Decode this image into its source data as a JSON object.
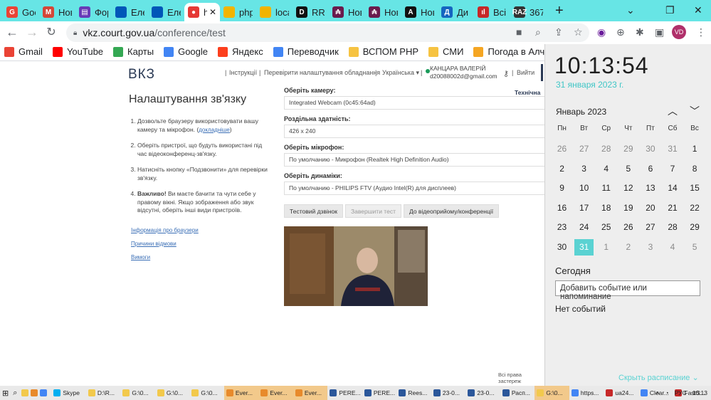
{
  "tabs": [
    {
      "label": "Goo",
      "color": "#ea4335",
      "glyph": "G"
    },
    {
      "label": "Нов",
      "color": "#d44638",
      "glyph": "M"
    },
    {
      "label": "Фор",
      "color": "#673ab7",
      "glyph": "▤"
    },
    {
      "label": "Еле",
      "color": "#0057b8",
      "glyph": ""
    },
    {
      "label": "Еле",
      "color": "#0057b8",
      "glyph": ""
    },
    {
      "label": "ht",
      "color": "#e53935",
      "glyph": "●",
      "active": true
    },
    {
      "label": "php",
      "color": "#f2b400",
      "glyph": ""
    },
    {
      "label": "loca",
      "color": "#f2b400",
      "glyph": ""
    },
    {
      "label": "RRF",
      "color": "#111111",
      "glyph": "D"
    },
    {
      "label": "Нов",
      "color": "#6a1b4d",
      "glyph": "₳"
    },
    {
      "label": "Нов",
      "color": "#6a1b4d",
      "glyph": "₳"
    },
    {
      "label": "Нов",
      "color": "#111111",
      "glyph": "A"
    },
    {
      "label": "Ди",
      "color": "#1565c0",
      "glyph": "Д"
    },
    {
      "label": "Всі",
      "color": "#c62828",
      "glyph": "ıl"
    },
    {
      "label": "367",
      "color": "#333333",
      "glyph": "RAZ"
    }
  ],
  "new_tab": "+",
  "url": {
    "host": "vkz.court.gov.ua",
    "path": "/conference/test"
  },
  "bookmarks": [
    {
      "label": "Gmail",
      "color": "#ea4335"
    },
    {
      "label": "YouTube",
      "color": "#ff0000"
    },
    {
      "label": "Карты",
      "color": "#34a853"
    },
    {
      "label": "Google",
      "color": "#4285f4"
    },
    {
      "label": "Яндекс",
      "color": "#fc3f1d"
    },
    {
      "label": "Переводчик",
      "color": "#4285f4"
    },
    {
      "label": "ВСПОМ РНР",
      "color": "#f6c342"
    },
    {
      "label": "СМИ",
      "color": "#f6c342"
    },
    {
      "label": "Погода в Алчевске",
      "color": "#f5a623"
    }
  ],
  "site": {
    "logo": "ВКЗ",
    "nav": [
      "Інструкції",
      "Перевірити налаштування обладнання",
      "Українська ▾"
    ],
    "user_name": "КАНЦАРА ВАЛЕРІЙ",
    "user_email": "d20088002d@gmail.com",
    "logout": "Вийти",
    "tech": "Технічна п",
    "title": "Налаштування зв'язку",
    "step1": "Дозвольте браузеру використовувати вашу камеру та мікрофон. (",
    "step1_link": "докладніше",
    "step1_end": ")",
    "step2": "Оберіть пристрої, що будуть використані під час відеоконференц-зв'язку.",
    "step3": "Натисніть кнопку «Подзвонити» для перевірки зв'язку.",
    "step4_bold": "Важливо!",
    "step4": " Ви маєте бачити та чути себе у правому вікні. Якщо зображення або звук відсутні, оберіть інші види пристроїв.",
    "links": [
      "Інформація про браузери",
      "Причини відмови",
      "Вимоги"
    ],
    "camera_label": "Оберіть камеру:",
    "camera_value": "Integrated Webcam (0c45:64ad)",
    "res_label": "Роздільна здатність:",
    "res_value": "426 x 240",
    "mic_label": "Оберіть мікрофон:",
    "mic_value": "По умолчанию - Микрофон (Realtek High Definition Audio)",
    "spk_label": "Оберіть динаміки:",
    "spk_value": "По умолчанию - PHILIPS FTV (Аудио Intel(R) для дисплеев)",
    "btn_test": "Тестовий дзвінок",
    "btn_end": "Завершити тест",
    "btn_vkz": "До відеоприйому/конференції",
    "rights": "Всі права застереж"
  },
  "calendar": {
    "time": "10:13:54",
    "date": "31 января 2023 г.",
    "month": "Январь 2023",
    "weekdays": [
      "Пн",
      "Вт",
      "Ср",
      "Чт",
      "Пт",
      "Сб",
      "Вс"
    ],
    "days": [
      {
        "d": "26",
        "o": true
      },
      {
        "d": "27",
        "o": true
      },
      {
        "d": "28",
        "o": true
      },
      {
        "d": "29",
        "o": true
      },
      {
        "d": "30",
        "o": true
      },
      {
        "d": "31",
        "o": true
      },
      {
        "d": "1"
      },
      {
        "d": "2"
      },
      {
        "d": "3"
      },
      {
        "d": "4"
      },
      {
        "d": "5"
      },
      {
        "d": "6"
      },
      {
        "d": "7"
      },
      {
        "d": "8"
      },
      {
        "d": "9"
      },
      {
        "d": "10"
      },
      {
        "d": "11"
      },
      {
        "d": "12"
      },
      {
        "d": "13"
      },
      {
        "d": "14"
      },
      {
        "d": "15"
      },
      {
        "d": "16"
      },
      {
        "d": "17"
      },
      {
        "d": "18"
      },
      {
        "d": "19"
      },
      {
        "d": "20"
      },
      {
        "d": "21"
      },
      {
        "d": "22"
      },
      {
        "d": "23"
      },
      {
        "d": "24"
      },
      {
        "d": "25"
      },
      {
        "d": "26"
      },
      {
        "d": "27"
      },
      {
        "d": "28"
      },
      {
        "d": "29"
      },
      {
        "d": "30"
      },
      {
        "d": "31",
        "t": true
      },
      {
        "d": "1",
        "o": true
      },
      {
        "d": "2",
        "o": true
      },
      {
        "d": "3",
        "o": true
      },
      {
        "d": "4",
        "o": true
      },
      {
        "d": "5",
        "o": true
      }
    ],
    "today_label": "Сегодня",
    "add_event": "Добавить событие или напоминание",
    "no_events": "Нет событий",
    "show_schedule": "Скрыть расписание ⌄"
  },
  "taskbar": [
    {
      "label": "Skype",
      "color": "#00aff0"
    },
    {
      "label": "D:\\R...",
      "color": "#f2c94c"
    },
    {
      "label": "G:\\0...",
      "color": "#f2c94c"
    },
    {
      "label": "G:\\0...",
      "color": "#f2c94c"
    },
    {
      "label": "G:\\0...",
      "color": "#f2c94c"
    },
    {
      "label": "Ever...",
      "color": "#e88a2b",
      "orange": true
    },
    {
      "label": "Ever...",
      "color": "#e88a2b",
      "orange": true
    },
    {
      "label": "Ever...",
      "color": "#e88a2b",
      "orange": true
    },
    {
      "label": "PERE...",
      "color": "#2b579a"
    },
    {
      "label": "PERE...",
      "color": "#2b579a"
    },
    {
      "label": "Rees...",
      "color": "#2b579a"
    },
    {
      "label": "23-0...",
      "color": "#2b579a"
    },
    {
      "label": "23-0...",
      "color": "#2b579a"
    },
    {
      "label": "Расп...",
      "color": "#2b579a"
    },
    {
      "label": "G:\\0...",
      "color": "#f2c94c",
      "orange": true
    },
    {
      "label": "https...",
      "color": "#4285f4"
    },
    {
      "label": "ua24...",
      "color": "#c62828"
    },
    {
      "label": "Clear...",
      "color": "#4285f4"
    },
    {
      "label": "FastS...",
      "color": "#c62828"
    }
  ],
  "tray": {
    "lang": "РУС",
    "time": "10:13"
  }
}
